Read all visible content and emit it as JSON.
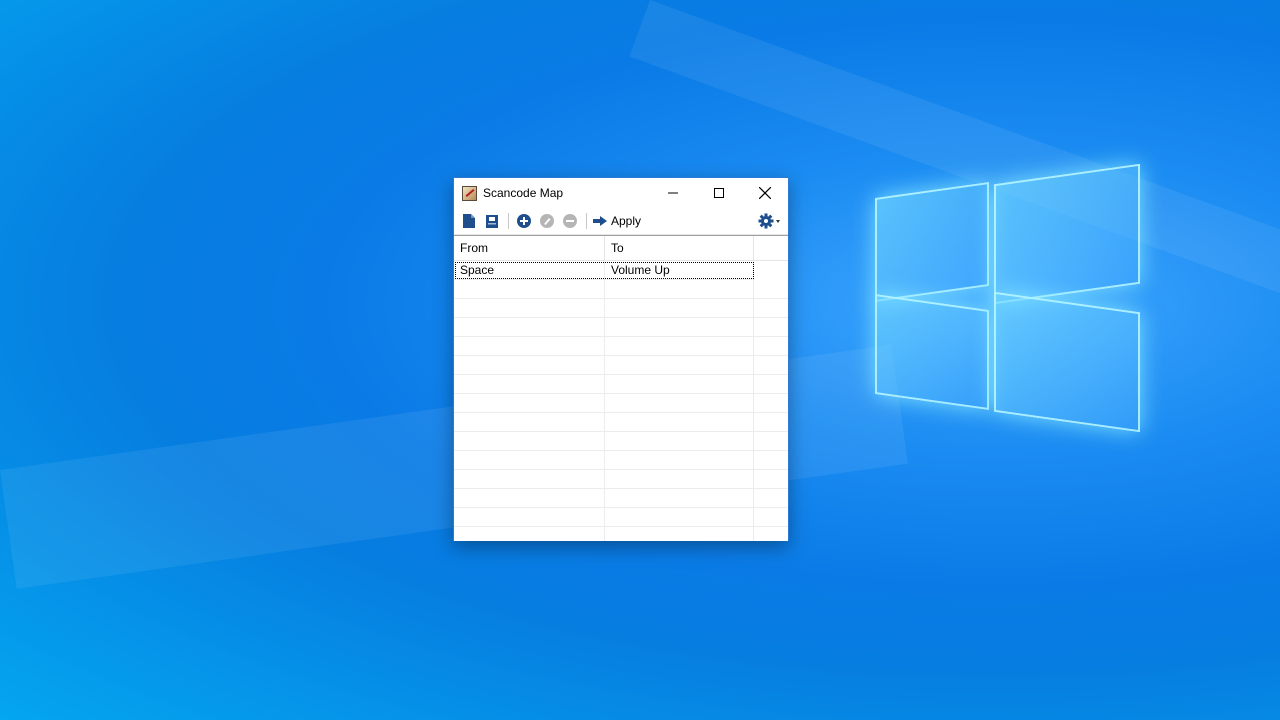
{
  "window": {
    "title": "Scancode Map"
  },
  "toolbar": {
    "apply_label": "Apply"
  },
  "table": {
    "columns": [
      "From",
      "To"
    ],
    "rows": [
      {
        "from": "Space",
        "to": "Volume Up"
      }
    ]
  }
}
